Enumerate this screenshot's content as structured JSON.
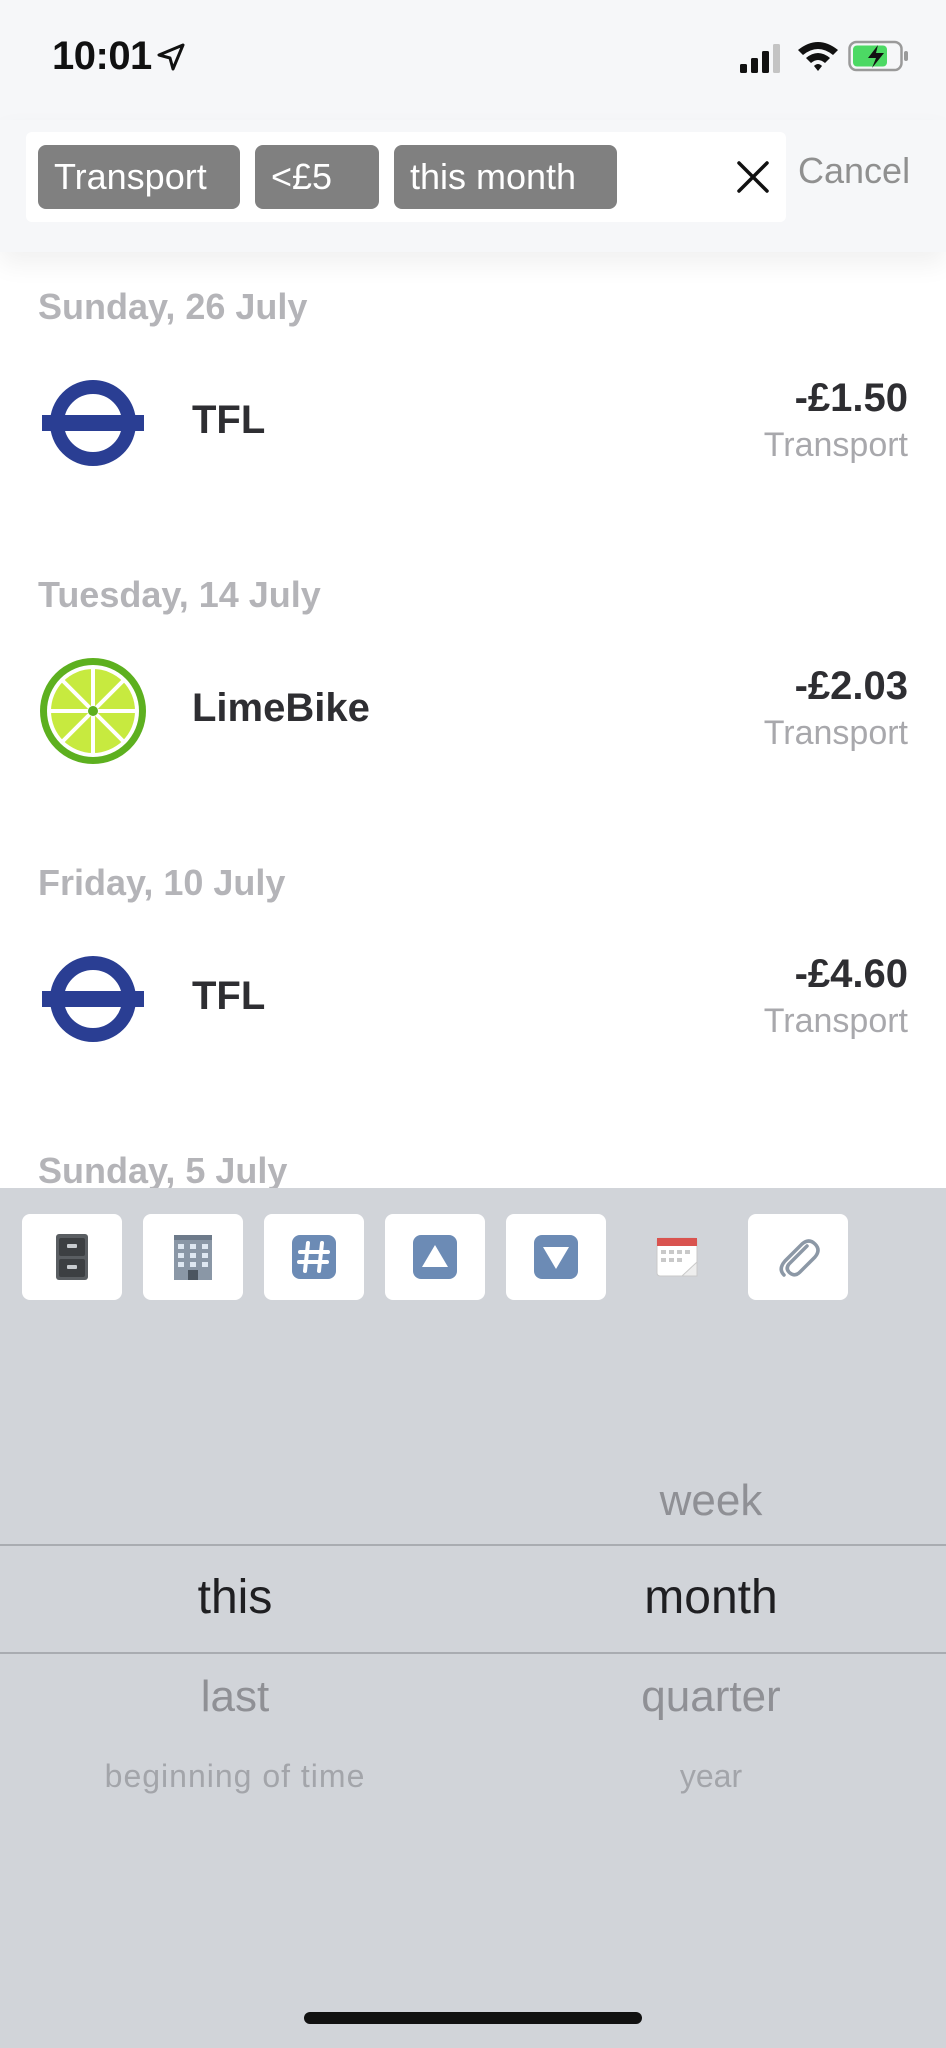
{
  "status_bar": {
    "time": "10:01"
  },
  "search": {
    "chips": [
      "Transport",
      "<£5",
      "this month"
    ],
    "cancel_label": "Cancel"
  },
  "transactions": [
    {
      "date": "Sunday, 26 July",
      "merchant": "TFL",
      "logo": "tfl-roundel",
      "amount": "-£1.50",
      "category": "Transport"
    },
    {
      "date": "Tuesday, 14 July",
      "merchant": "LimeBike",
      "logo": "lime-slice",
      "amount": "-£2.03",
      "category": "Transport"
    },
    {
      "date": "Friday, 10 July",
      "merchant": "TFL",
      "logo": "tfl-roundel",
      "amount": "-£4.60",
      "category": "Transport"
    },
    {
      "date": "Sunday, 5 July"
    }
  ],
  "toolbar": {
    "buttons": [
      {
        "icon": "filing-cabinet-icon"
      },
      {
        "icon": "office-building-icon"
      },
      {
        "icon": "hashtag-icon"
      },
      {
        "icon": "up-arrow-icon"
      },
      {
        "icon": "down-arrow-icon"
      },
      {
        "icon": "calendar-icon"
      },
      {
        "icon": "paperclip-icon"
      }
    ]
  },
  "picker": {
    "left_column": {
      "selected": "this",
      "below": [
        "last",
        "beginning of time"
      ]
    },
    "right_column": {
      "above": [
        "week"
      ],
      "selected": "month",
      "below": [
        "quarter",
        "year"
      ]
    }
  },
  "colors": {
    "tfl_blue": "#2a3e93",
    "lime_green": "#74c52a",
    "chip_bg": "#808080",
    "picker_bg": "#d1d4d9"
  }
}
